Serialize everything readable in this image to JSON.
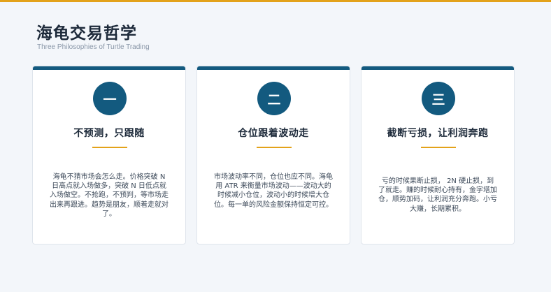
{
  "page": {
    "title": "海龟交易哲学",
    "subtitle": "Three Philosophies of Turtle Trading"
  },
  "cards": [
    {
      "number": "一",
      "title": "不预测，只跟随",
      "body": "海龟不猜市场会怎么走。价格突破 N 日高点就入场做多，突破 N 日低点就入场做空。不抢跑，不预判，等市场走出来再跟进。趋势是朋友，顺着走就对了。"
    },
    {
      "number": "二",
      "title": "仓位跟着波动走",
      "body": "市场波动率不同，仓位也应不同。海龟用 ATR 来衡量市场波动——波动大的时候减小仓位，波动小的时候增大仓位。每一单的风险金额保持恒定可控。"
    },
    {
      "number": "三",
      "title": "截断亏损，让利润奔跑",
      "body": "亏的时候果断止损， 2N 硬止损，到了就走。赚的时候耐心持有，金字塔加仓，顺势加码，让利润充分奔跑。小亏大赚，长期累积。"
    }
  ],
  "colors": {
    "accent_gold": "#e3a21a",
    "brand_navy": "#135a7f"
  }
}
